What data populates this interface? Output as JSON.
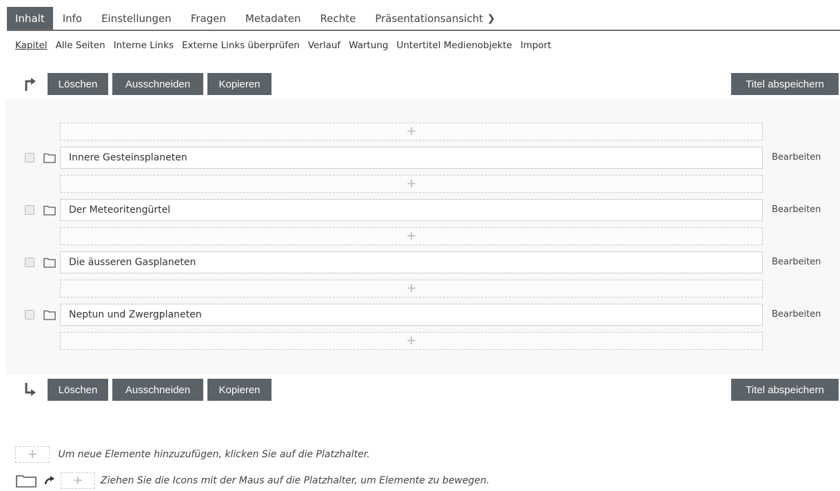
{
  "tabs": [
    "Inhalt",
    "Info",
    "Einstellungen",
    "Fragen",
    "Metadaten",
    "Rechte",
    "Präsentationsansicht"
  ],
  "subtabs": [
    "Kapitel",
    "Alle Seiten",
    "Interne Links",
    "Externe Links überprüfen",
    "Verlauf",
    "Wartung",
    "Untertitel Medienobjekte",
    "Import"
  ],
  "toolbar": {
    "delete_label": "Löschen",
    "cut_label": "Ausschneiden",
    "copy_label": "Kopieren",
    "save_titles_label": "Titel abspeichern"
  },
  "chapters": [
    {
      "title": "Innere Gesteinsplaneten",
      "edit_label": "Bearbeiten"
    },
    {
      "title": "Der Meteoritengürtel",
      "edit_label": "Bearbeiten"
    },
    {
      "title": "Die äusseren Gasplaneten",
      "edit_label": "Bearbeiten"
    },
    {
      "title": "Neptun und Zwergplaneten",
      "edit_label": "Bearbeiten"
    }
  ],
  "legend": {
    "add_hint": "Um neue Elemente hinzuzufügen, klicken Sie auf die Platzhalter.",
    "move_hint": "Ziehen Sie die Icons mit der Maus auf die Platzhalter, um Elemente zu bewegen."
  },
  "icons": {
    "slot": "plus-icon",
    "chapter": "folder-icon",
    "move": "arrow-icon"
  },
  "colors": {
    "button_bg": "#5b6268",
    "active_tab_bg": "#5b6268",
    "panel_bg": "#f8f8f8"
  }
}
